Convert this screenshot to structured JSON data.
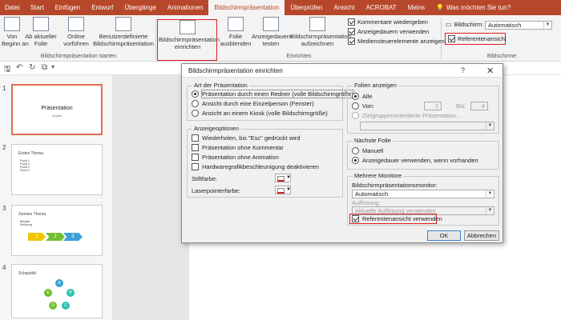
{
  "tabs": [
    "Datei",
    "Start",
    "Einfügen",
    "Entwurf",
    "Übergänge",
    "Animationen",
    "Bildschirmpräsentation",
    "Überprüfen",
    "Ansicht",
    "ACROBAT",
    "Meins"
  ],
  "tell_me": "Was möchten Sie tun?",
  "ribbon": {
    "from_start": "Von\nBeginn an",
    "from_current": "Ab aktueller\nFolie",
    "online": "Online\nvorführen",
    "custom": "Benutzerdefinierte\nBildschirmpräsentation",
    "group_start": "Bildschirmpräsentation starten",
    "setup": "Bildschirmpräsentation\neinrichten",
    "hide": "Folie\nausblenden",
    "rehearse": "Anzeigedauern\ntesten",
    "record": "Bildschirmpräsentation\naufzeichnen",
    "chk_comments": "Kommentare wiedergeben",
    "chk_timings": "Anzeigedauern verwenden",
    "chk_media": "Mediensteuerelemente anzeigen",
    "group_setup": "Einrichten",
    "monitor_label": "Bildschirm:",
    "monitor_value": "Automatisch",
    "presenter": "Referentenansicht",
    "group_monitors": "Bildschirme"
  },
  "thumbs": [
    {
      "num": "1",
      "title": "Präsentation",
      "sub": "Kapitel"
    },
    {
      "num": "2",
      "title": "Erstes Thema",
      "bullets": [
        "Punkt 1",
        "Punkt 2",
        "Punkt 3",
        "Punkt 4"
      ]
    },
    {
      "num": "3",
      "title": "Zweites Thema",
      "bullets": [
        "Beispiel",
        "Erklärung"
      ],
      "steps": [
        "1",
        "2",
        "3"
      ]
    },
    {
      "num": "4",
      "title": "Schaubild",
      "nodes": [
        "A",
        "B",
        "C",
        "D",
        "E"
      ]
    }
  ],
  "dialog": {
    "title": "Bildschirmpräsentation einrichten",
    "help": "?",
    "close": "✕",
    "art_legend": "Art der Präsentation",
    "art": [
      "Präsentation durch einen Redner (volle Bildschirmgröße)",
      "Ansicht durch eine Einzelperson (Fenster)",
      "Ansicht an einem Kiosk (volle Bildschirmgröße)"
    ],
    "opt_legend": "Anzeigeoptionen",
    "opts": [
      "Wiederholen, bis \"Esc\" gedrückt wird",
      "Präsentation ohne Kommentar",
      "Präsentation ohne Animation",
      "Hardwaregrafikbeschleunigung deaktivieren"
    ],
    "pen": "Stiftfarbe:",
    "laser": "Laserpointerfarbe:",
    "show_legend": "Folien anzeigen",
    "all": "Alle",
    "from": "Von:",
    "from_value": "1",
    "to": "Bis:",
    "to_value": "4",
    "custom": "Zielgruppenorientierte Präsentation...",
    "next_legend": "Nächste Folie",
    "manual": "Manuell",
    "use_timings": "Anzeigedauer verwenden, wenn vorhanden",
    "mon_legend": "Mehrere Monitore",
    "mon_label": "Bildschirmpräsentationsmonitor:",
    "mon_value": "Automatisch",
    "res_label": "Auflösung:",
    "res_value": "Aktuelle Auflösung verwenden",
    "presenter": "Referentenansicht verwenden",
    "ok": "OK",
    "cancel": "Abbrechen"
  }
}
